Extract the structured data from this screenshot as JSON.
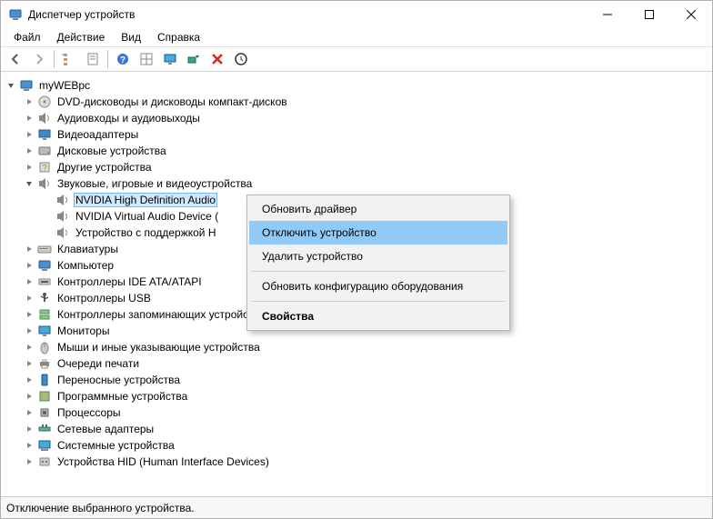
{
  "window": {
    "title": "Диспетчер устройств"
  },
  "menu": {
    "file": "Файл",
    "action": "Действие",
    "view": "Вид",
    "help": "Справка"
  },
  "toolbar_icons": {
    "back": "back-icon",
    "forward": "forward-icon",
    "show_hidden": "show-hidden-icon",
    "properties": "properties-icon",
    "help": "help-icon",
    "list": "list-icon",
    "monitor": "monitor-icon",
    "scan": "scan-icon",
    "remove": "remove-icon",
    "refresh": "refresh-icon"
  },
  "tree": {
    "root": "myWEBpc",
    "categories": {
      "dvd": "DVD-дисководы и дисководы компакт-дисков",
      "audio_io": "Аудиовходы и аудиовыходы",
      "video": "Видеоадаптеры",
      "disk": "Дисковые устройства",
      "other": "Другие устройства",
      "sound": "Звуковые, игровые и видеоустройства",
      "keyboards": "Клавиатуры",
      "computer": "Компьютер",
      "ide": "Контроллеры IDE ATA/ATAPI",
      "usb": "Контроллеры USB",
      "storage_ctrl": "Контроллеры запоминающих устройств",
      "monitors": "Мониторы",
      "mice": "Мыши и иные указывающие устройства",
      "print_queues": "Очереди печати",
      "portable": "Переносные устройства",
      "software_dev": "Программные устройства",
      "processors": "Процессоры",
      "network": "Сетевые адаптеры",
      "system": "Системные устройства",
      "hid": "Устройства HID (Human Interface Devices)"
    },
    "sound_children": {
      "nvidia_hd": "NVIDIA High Definition Audio",
      "nvidia_virtual": "NVIDIA Virtual Audio Device (",
      "hd_device": "Устройство с поддержкой H"
    }
  },
  "context_menu": {
    "update": "Обновить драйвер",
    "disable": "Отключить устройство",
    "uninstall": "Удалить устройство",
    "scan": "Обновить конфигурацию оборудования",
    "properties": "Свойства"
  },
  "statusbar": {
    "text": "Отключение выбранного устройства."
  }
}
